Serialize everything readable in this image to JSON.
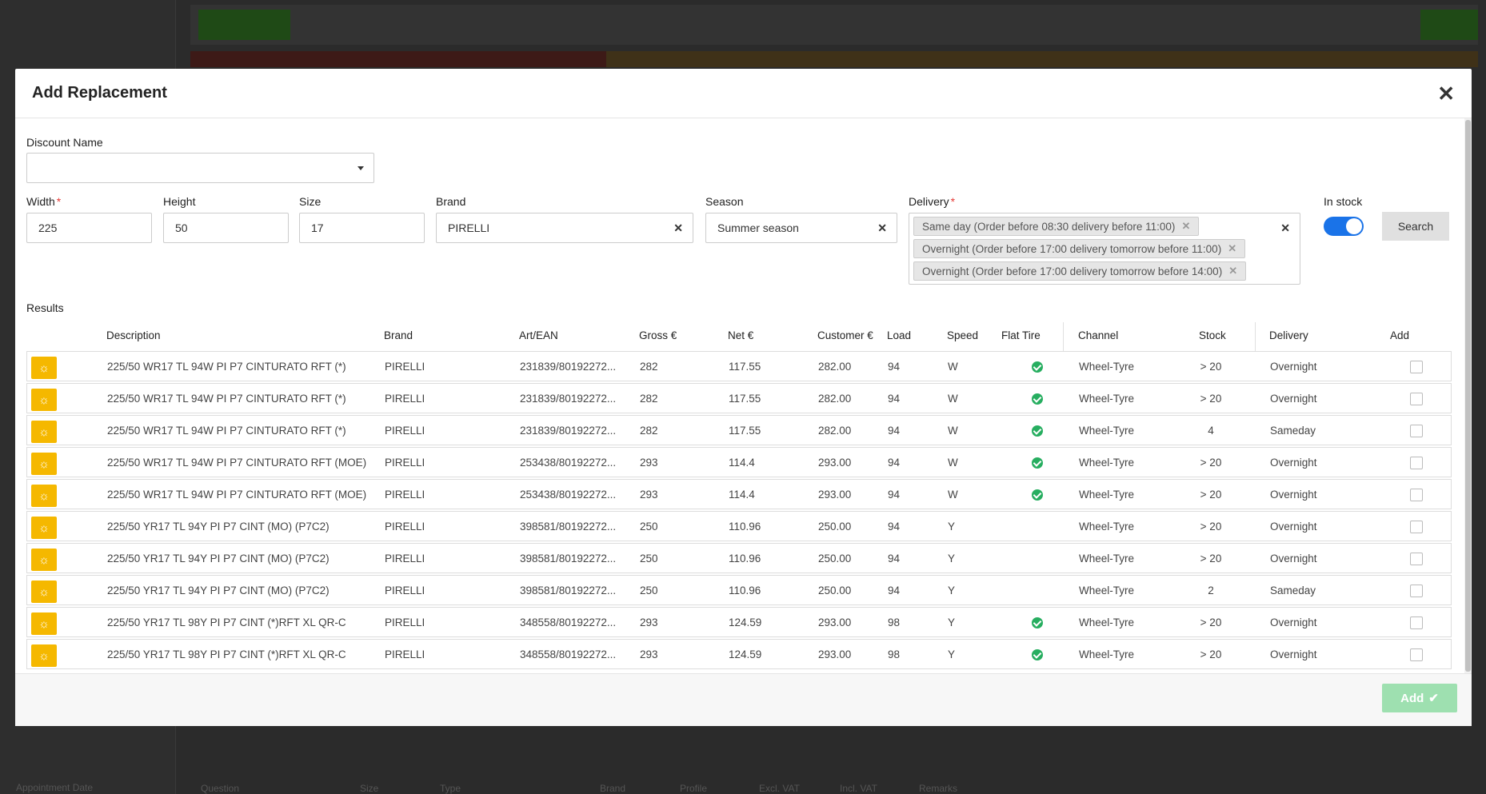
{
  "modal": {
    "title": "Add Replacement",
    "close_icon": "close-icon",
    "add_label": "Add"
  },
  "form": {
    "discount_name": {
      "label": "Discount Name",
      "value": ""
    },
    "width": {
      "label": "Width",
      "value": "225"
    },
    "height": {
      "label": "Height",
      "value": "50"
    },
    "size": {
      "label": "Size",
      "value": "17"
    },
    "brand": {
      "label": "Brand",
      "value": "PIRELLI"
    },
    "season": {
      "label": "Season",
      "value": "Summer season"
    },
    "delivery": {
      "label": "Delivery",
      "tags": [
        "Same day (Order before 08:30 delivery before 11:00)",
        "Overnight (Order before 17:00 delivery tomorrow before 11:00)",
        "Overnight (Order before 17:00 delivery tomorrow before 14:00)"
      ]
    },
    "in_stock": {
      "label": "In stock",
      "checked": true
    },
    "search_label": "Search"
  },
  "results": {
    "label": "Results",
    "headers": [
      "Description",
      "Brand",
      "Art/EAN",
      "Gross €",
      "Net €",
      "Customer €",
      "Load",
      "Speed",
      "Flat Tire",
      "Channel",
      "Stock",
      "Delivery",
      "Add"
    ],
    "rows": [
      {
        "desc": "225/50 WR17 TL 94W PI P7 CINTURATO RFT (*)",
        "brand": "PIRELLI",
        "ean": "231839/80192272...",
        "gross": "282",
        "net": "117.55",
        "customer": "282.00",
        "load": "94",
        "speed": "W",
        "flat": true,
        "channel": "Wheel-Tyre",
        "stock": "> 20",
        "delivery": "Overnight"
      },
      {
        "desc": "225/50 WR17 TL 94W PI P7 CINTURATO RFT (*)",
        "brand": "PIRELLI",
        "ean": "231839/80192272...",
        "gross": "282",
        "net": "117.55",
        "customer": "282.00",
        "load": "94",
        "speed": "W",
        "flat": true,
        "channel": "Wheel-Tyre",
        "stock": "> 20",
        "delivery": "Overnight"
      },
      {
        "desc": "225/50 WR17 TL 94W PI P7 CINTURATO RFT (*)",
        "brand": "PIRELLI",
        "ean": "231839/80192272...",
        "gross": "282",
        "net": "117.55",
        "customer": "282.00",
        "load": "94",
        "speed": "W",
        "flat": true,
        "channel": "Wheel-Tyre",
        "stock": "4",
        "delivery": "Sameday"
      },
      {
        "desc": "225/50 WR17 TL 94W PI P7 CINTURATO RFT (MOE)",
        "brand": "PIRELLI",
        "ean": "253438/80192272...",
        "gross": "293",
        "net": "114.4",
        "customer": "293.00",
        "load": "94",
        "speed": "W",
        "flat": true,
        "channel": "Wheel-Tyre",
        "stock": "> 20",
        "delivery": "Overnight"
      },
      {
        "desc": "225/50 WR17 TL 94W PI P7 CINTURATO RFT (MOE)",
        "brand": "PIRELLI",
        "ean": "253438/80192272...",
        "gross": "293",
        "net": "114.4",
        "customer": "293.00",
        "load": "94",
        "speed": "W",
        "flat": true,
        "channel": "Wheel-Tyre",
        "stock": "> 20",
        "delivery": "Overnight"
      },
      {
        "desc": "225/50 YR17 TL 94Y PI P7 CINT (MO) (P7C2)",
        "brand": "PIRELLI",
        "ean": "398581/80192272...",
        "gross": "250",
        "net": "110.96",
        "customer": "250.00",
        "load": "94",
        "speed": "Y",
        "flat": false,
        "channel": "Wheel-Tyre",
        "stock": "> 20",
        "delivery": "Overnight"
      },
      {
        "desc": "225/50 YR17 TL 94Y PI P7 CINT (MO) (P7C2)",
        "brand": "PIRELLI",
        "ean": "398581/80192272...",
        "gross": "250",
        "net": "110.96",
        "customer": "250.00",
        "load": "94",
        "speed": "Y",
        "flat": false,
        "channel": "Wheel-Tyre",
        "stock": "> 20",
        "delivery": "Overnight"
      },
      {
        "desc": "225/50 YR17 TL 94Y PI P7 CINT (MO) (P7C2)",
        "brand": "PIRELLI",
        "ean": "398581/80192272...",
        "gross": "250",
        "net": "110.96",
        "customer": "250.00",
        "load": "94",
        "speed": "Y",
        "flat": false,
        "channel": "Wheel-Tyre",
        "stock": "2",
        "delivery": "Sameday"
      },
      {
        "desc": "225/50 YR17 TL 98Y PI P7 CINT (*)RFT XL QR-C",
        "brand": "PIRELLI",
        "ean": "348558/80192272...",
        "gross": "293",
        "net": "124.59",
        "customer": "293.00",
        "load": "98",
        "speed": "Y",
        "flat": true,
        "channel": "Wheel-Tyre",
        "stock": "> 20",
        "delivery": "Overnight"
      },
      {
        "desc": "225/50 YR17 TL 98Y PI P7 CINT (*)RFT XL QR-C",
        "brand": "PIRELLI",
        "ean": "348558/80192272...",
        "gross": "293",
        "net": "124.59",
        "customer": "293.00",
        "load": "98",
        "speed": "Y",
        "flat": true,
        "channel": "Wheel-Tyre",
        "stock": "> 20",
        "delivery": "Overnight"
      }
    ]
  },
  "background": {
    "bottom_text": "Appointment Date",
    "columns": [
      "Question",
      "Size",
      "Type",
      "Brand",
      "Profile",
      "Excl. VAT",
      "Incl. VAT",
      "Remarks"
    ]
  },
  "colors": {
    "season_icon_bg": "#f5b800",
    "toggle_on": "#1a73e8",
    "flat_ok": "#27ae60",
    "add_button": "#9ee0b0"
  }
}
